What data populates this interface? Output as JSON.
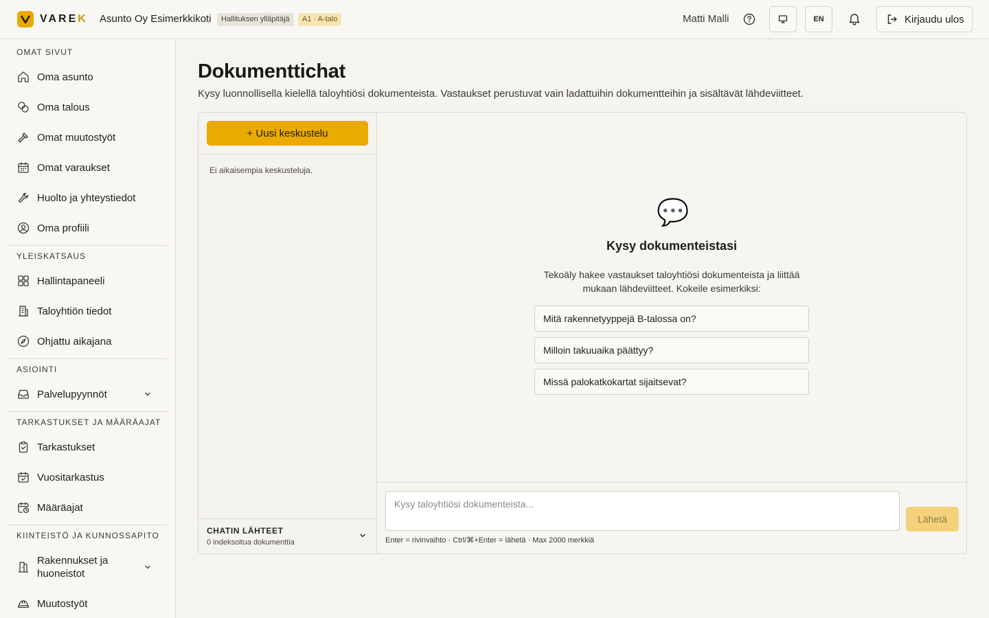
{
  "header": {
    "logo_prefix": "VARE",
    "logo_accent": "K",
    "company": "Asunto Oy Esimerkkikoti",
    "role_badge": "Hallituksen ylläpitäjä",
    "unit_badge": "A1 · A-talo",
    "user_name": "Matti Malli",
    "language_button": "EN",
    "logout_label": "Kirjaudu ulos"
  },
  "sidebar": {
    "sections": [
      {
        "title": "OMAT SIVUT",
        "items": [
          "Oma asunto",
          "Oma talous",
          "Omat muutostyöt",
          "Omat varaukset",
          "Huolto ja yhteystiedot",
          "Oma profiili"
        ]
      },
      {
        "title": "YLEISKATSAUS",
        "items": [
          "Hallintapaneeli",
          "Taloyhtiön tiedot",
          "Ohjattu aikajana"
        ]
      },
      {
        "title": "ASIOINTI",
        "items": [
          "Palvelupyynnöt"
        ]
      },
      {
        "title": "TARKASTUKSET JA MÄÄRÄAJAT",
        "items": [
          "Tarkastukset",
          "Vuositarkastus",
          "Määräajat"
        ]
      },
      {
        "title": "KIINTEISTÖ JA KUNNOSSAPITO",
        "items": [
          "Rakennukset ja huoneistot",
          "Muutostyöt"
        ]
      }
    ]
  },
  "main": {
    "title": "Dokumenttichat",
    "subtitle": "Kysy luonnollisella kielellä taloyhtiösi dokumenteista. Vastaukset perustuvat vain ladattuihin dokumentteihin ja sisältävät lähdeviitteet.",
    "new_chat_label": "+ Uusi keskustelu",
    "no_chats_text": "Ei aikaisempia keskusteluja.",
    "sources_title": "CHATIN LÄHTEET",
    "sources_count": "0 indeksoitua dokumenttia",
    "empty_icon": "💬",
    "empty_title": "Kysy dokumenteistasi",
    "empty_description": "Tekoäly hakee vastaukset taloyhtiösi dokumenteista ja liittää mukaan lähdeviitteet. Kokeile esimerkiksi:",
    "suggestions": [
      "Mitä rakennetyyppejä B-talossa on?",
      "Milloin takuuaika päättyy?",
      "Missä palokatkokartat sijaitsevat?"
    ],
    "input_placeholder": "Kysy taloyhtiösi dokumenteista...",
    "send_label": "Lähetä",
    "hint": "Enter = rivinvaihto · Ctrl/⌘+Enter = lähetä · Max 2000 merkkiä"
  },
  "colors": {
    "accent": "#eaaa00",
    "send_disabled": "#f3d27b",
    "background": "#f5f4ef"
  }
}
